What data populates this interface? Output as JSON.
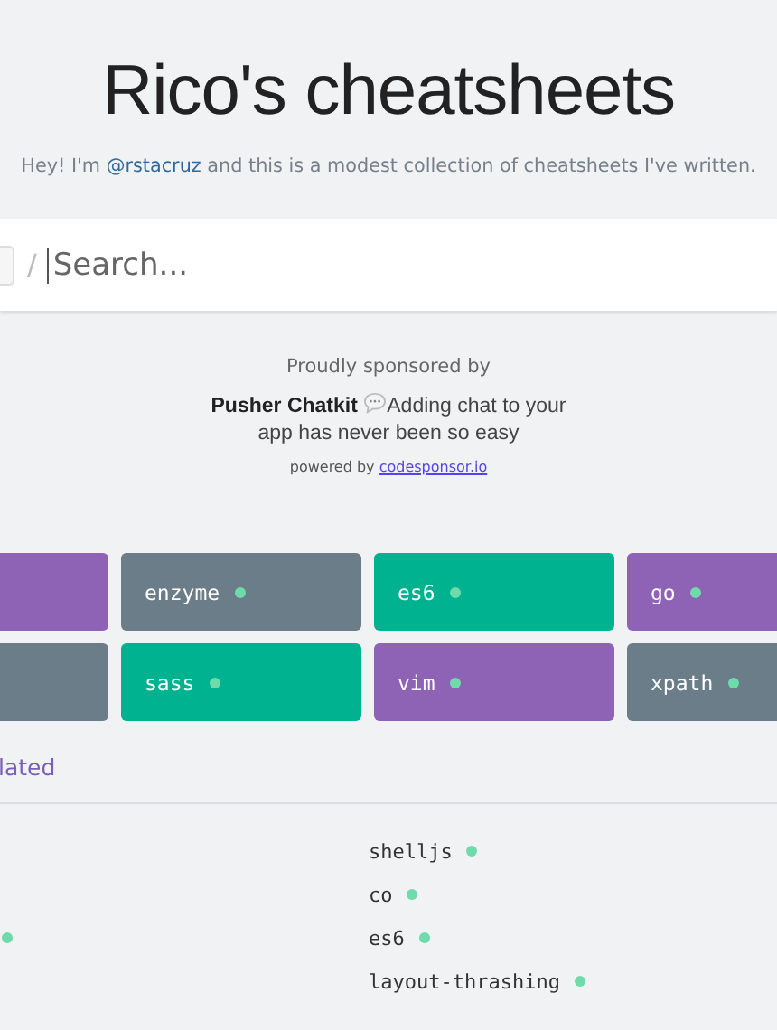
{
  "header": {
    "title": "Rico's cheatsheets",
    "intro_before": "Hey! I'm ",
    "intro_link": "@rstacruz",
    "intro_after": " and this is a modest collection of cheatsheets I've written."
  },
  "search": {
    "separator": "/",
    "placeholder": "Search..."
  },
  "sponsor": {
    "caption": "Proudly sponsored by",
    "brand": "Pusher Chatkit",
    "message": "Adding chat to your app has never been so easy",
    "powered_by": "powered by",
    "powered_link": "codesponsor.io"
  },
  "cards": [
    {
      "color": "#8e62b5"
    },
    {
      "name": "enzyme",
      "color": "#6b7d88"
    },
    {
      "name": "es6",
      "color": "#00b28f"
    },
    {
      "name": "go",
      "color": "#8e62b5"
    },
    {
      "color": "#6b7d88"
    },
    {
      "name": "sass",
      "color": "#00b28f"
    },
    {
      "name": "vim",
      "color": "#8e62b5"
    },
    {
      "name": "xpath",
      "color": "#6b7d88"
    }
  ],
  "recent": {
    "heading": "lated",
    "left_rows": [
      {
        "dot": false
      },
      {
        "dot": false
      },
      {
        "dot": true
      }
    ],
    "right_items": [
      {
        "name": "shelljs"
      },
      {
        "name": "co"
      },
      {
        "name": "es6"
      },
      {
        "name": "layout-thrashing"
      }
    ]
  }
}
